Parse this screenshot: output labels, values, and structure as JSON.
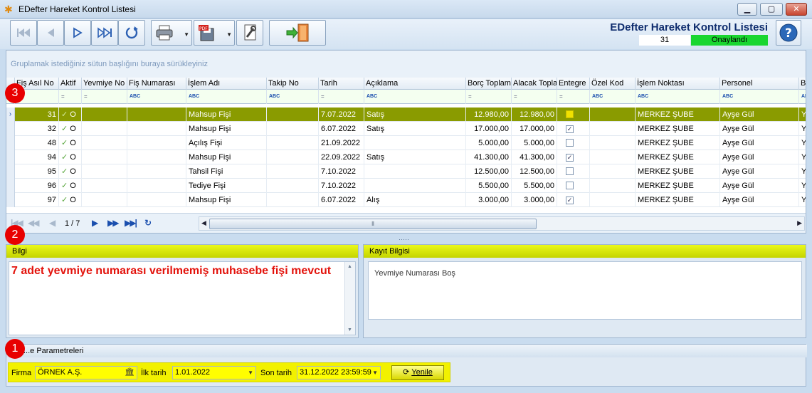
{
  "window": {
    "title": "EDefter Hareket Kontrol Listesi"
  },
  "toolbar": {
    "buttons": [
      "first-record",
      "previous-record",
      "next-record",
      "last-record",
      "refresh",
      "print",
      "export-pdf",
      "settings",
      "exit"
    ],
    "report_title": "EDefter Hareket Kontrol Listesi",
    "count": "31",
    "status": "Onaylandı",
    "status_color": "#19d630"
  },
  "grid": {
    "group_hint": "Gruplamak istediğiniz sütun başlığını buraya sürükleyiniz",
    "columns": [
      "Fiş Asıl No",
      "Aktif",
      "Yevmiye No",
      "Fiş Numarası",
      "İşlem Adı",
      "Takip No",
      "Tarih",
      "Açıklama",
      "Borç Toplamı",
      "Alacak Toplam",
      "Entegre",
      "Özel Kod",
      "İşlem Noktası",
      "Personel",
      "Bi"
    ],
    "filter_row": [
      "",
      "=",
      "=",
      "ABC",
      "ABC",
      "ABC",
      "=",
      "ABC",
      "=",
      "=",
      "=",
      "ABC",
      "ABC",
      "ABC",
      "ABC"
    ],
    "rows": [
      {
        "fis_asil_no": "31",
        "aktif": "O",
        "yevmiye_no": "",
        "fis_numarasi": "",
        "islem_adi": "Mahsup Fişi",
        "takip_no": "",
        "tarih": "7.07.2022",
        "aciklama": "Satış",
        "borc": "12.980,00",
        "alacak": "12.980,00",
        "entegre": false,
        "ozel_kod": "",
        "islem_noktasi": "MERKEZ ŞUBE",
        "personel": "Ayşe Gül",
        "bi": "Ye",
        "selected": true
      },
      {
        "fis_asil_no": "32",
        "aktif": "O",
        "yevmiye_no": "",
        "fis_numarasi": "",
        "islem_adi": "Mahsup Fişi",
        "takip_no": "",
        "tarih": "6.07.2022",
        "aciklama": "Satış",
        "borc": "17.000,00",
        "alacak": "17.000,00",
        "entegre": true,
        "ozel_kod": "",
        "islem_noktasi": "MERKEZ ŞUBE",
        "personel": "Ayşe Gül",
        "bi": "Ye",
        "selected": false
      },
      {
        "fis_asil_no": "48",
        "aktif": "O",
        "yevmiye_no": "",
        "fis_numarasi": "",
        "islem_adi": "Açılış Fişi",
        "takip_no": "",
        "tarih": "21.09.2022",
        "aciklama": "",
        "borc": "5.000,00",
        "alacak": "5.000,00",
        "entegre": false,
        "ozel_kod": "",
        "islem_noktasi": "MERKEZ ŞUBE",
        "personel": "Ayşe Gül",
        "bi": "Ye",
        "selected": false
      },
      {
        "fis_asil_no": "94",
        "aktif": "O",
        "yevmiye_no": "",
        "fis_numarasi": "",
        "islem_adi": "Mahsup Fişi",
        "takip_no": "",
        "tarih": "22.09.2022",
        "aciklama": "Satış",
        "borc": "41.300,00",
        "alacak": "41.300,00",
        "entegre": true,
        "ozel_kod": "",
        "islem_noktasi": "MERKEZ ŞUBE",
        "personel": "Ayşe Gül",
        "bi": "Ye",
        "selected": false
      },
      {
        "fis_asil_no": "95",
        "aktif": "O",
        "yevmiye_no": "",
        "fis_numarasi": "",
        "islem_adi": "Tahsil Fişi",
        "takip_no": "",
        "tarih": "7.10.2022",
        "aciklama": "",
        "borc": "12.500,00",
        "alacak": "12.500,00",
        "entegre": false,
        "ozel_kod": "",
        "islem_noktasi": "MERKEZ ŞUBE",
        "personel": "Ayşe Gül",
        "bi": "Ye",
        "selected": false
      },
      {
        "fis_asil_no": "96",
        "aktif": "O",
        "yevmiye_no": "",
        "fis_numarasi": "",
        "islem_adi": "Tediye Fişi",
        "takip_no": "",
        "tarih": "7.10.2022",
        "aciklama": "",
        "borc": "5.500,00",
        "alacak": "5.500,00",
        "entegre": false,
        "ozel_kod": "",
        "islem_noktasi": "MERKEZ ŞUBE",
        "personel": "Ayşe Gül",
        "bi": "Ye",
        "selected": false
      },
      {
        "fis_asil_no": "97",
        "aktif": "O",
        "yevmiye_no": "",
        "fis_numarasi": "",
        "islem_adi": "Mahsup Fişi",
        "takip_no": "",
        "tarih": "6.07.2022",
        "aciklama": "Alış",
        "borc": "3.000,00",
        "alacak": "3.000,00",
        "entegre": true,
        "ozel_kod": "",
        "islem_noktasi": "MERKEZ ŞUBE",
        "personel": "Ayşe Gül",
        "bi": "Ye",
        "selected": false
      }
    ],
    "selected_row_color": "#8a9b00",
    "page_info": "1 / 7"
  },
  "bilgi": {
    "title": "Bilgi",
    "text": "7 adet yevmiye numarası verilmemiş muhasebe fişi mevcut",
    "text_color": "#e3130c"
  },
  "kayit": {
    "title": "Kayıt Bilgisi",
    "text": "Yevmiye Numarası Boş"
  },
  "params": {
    "title": "...e Parametreleri",
    "firma_label": "Firma",
    "firma_value": "ÖRNEK A.Ş.",
    "ilk_tarih_label": "İlk tarih",
    "ilk_tarih_value": "1.01.2022",
    "son_tarih_label": "Son tarih",
    "son_tarih_value": "31.12.2022 23:59:59",
    "yenile_label": "Yenile"
  },
  "markers": [
    "3",
    "2",
    "1"
  ],
  "accent_yellow": "#f2f100"
}
